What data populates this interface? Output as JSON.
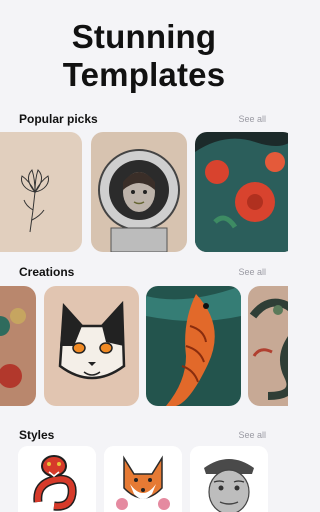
{
  "hero": {
    "line1": "Stunning",
    "line2": "Templates"
  },
  "sections": {
    "popular": {
      "title": "Popular picks",
      "see_all": "See all"
    },
    "creations": {
      "title": "Creations",
      "see_all": "See all"
    },
    "styles": {
      "title": "Styles",
      "see_all": "See all"
    }
  },
  "colors": {
    "background": "#f4f4f7",
    "see_all": "#9a9aa3"
  },
  "icons": {
    "popular": [
      "lotus-tattoo-image",
      "astronaut-girl-tattoo-image",
      "japanese-flower-tattoo-image"
    ],
    "creations": [
      "rose-tattoo-image",
      "cat-tattoo-image",
      "koi-fish-tattoo-image",
      "dragon-tattoo-image"
    ],
    "styles": [
      "snake-sticker-image",
      "fox-sticker-image",
      "old-man-portrait-image"
    ]
  }
}
